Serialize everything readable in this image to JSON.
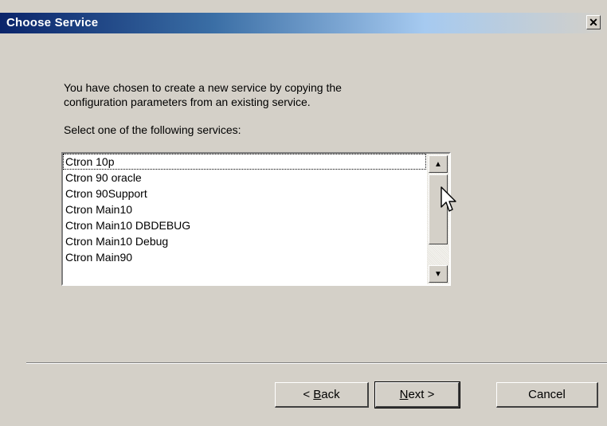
{
  "window": {
    "title": "Choose Service",
    "close_glyph": "✕"
  },
  "content": {
    "description_line1": "You have chosen to create a new service by copying the",
    "description_line2": "configuration parameters from an existing service.",
    "prompt": "Select one of the following services:"
  },
  "services": {
    "items": [
      "Ctron 10p",
      "Ctron 90 oracle",
      "Ctron 90Support",
      "Ctron Main10",
      "Ctron Main10 DBDEBUG",
      "Ctron Main10 Debug",
      "Ctron Main90"
    ],
    "focused_item": "Ctron 10p"
  },
  "scrollbar": {
    "up_icon": "▲",
    "down_icon": "▼"
  },
  "buttons": {
    "back_prefix": "< ",
    "back_mnemonic": "B",
    "back_rest": "ack",
    "next_mnemonic": "N",
    "next_rest": "ext >",
    "cancel": "Cancel"
  },
  "colors": {
    "dialog_bg": "#d4d0c8",
    "titlebar_start": "#0a246a",
    "titlebar_end": "#a6caf0"
  }
}
